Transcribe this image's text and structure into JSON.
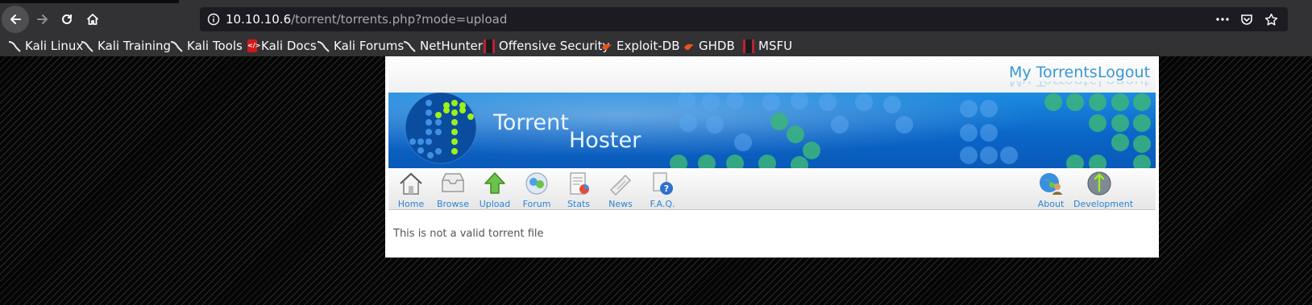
{
  "browser": {
    "url_host": "10.10.10.6",
    "url_path": "/torrent/torrents.php?mode=upload"
  },
  "bookmarks": [
    {
      "label": "Kali Linux",
      "icon": "kali-dragon-icon"
    },
    {
      "label": "Kali Training",
      "icon": "kali-dragon-icon"
    },
    {
      "label": "Kali Tools",
      "icon": "kali-dragon-icon"
    },
    {
      "label": "Kali Docs",
      "icon": "kali-docs-icon"
    },
    {
      "label": "Kali Forums",
      "icon": "kali-dragon-icon"
    },
    {
      "label": "NetHunter",
      "icon": "kali-dragon-icon"
    },
    {
      "label": "Offensive Security",
      "icon": "offsec-icon"
    },
    {
      "label": "Exploit-DB",
      "icon": "exploitdb-icon"
    },
    {
      "label": "GHDB",
      "icon": "exploitdb-icon"
    },
    {
      "label": "MSFU",
      "icon": "offsec-icon"
    }
  ],
  "site": {
    "header_links": {
      "my_torrents": "My Torrents",
      "logout": "Logout"
    },
    "logo": {
      "line1": "Torrent",
      "line2": "Hoster"
    },
    "menu": {
      "home": "Home",
      "browse": "Browse",
      "upload": "Upload",
      "forum": "Forum",
      "stats": "Stats",
      "news": "News",
      "faq": "F.A.Q.",
      "about": "About",
      "development": "Development"
    },
    "message": "This is not a valid torrent file"
  },
  "colors": {
    "link_blue": "#3797d8",
    "banner_blue": "#0a66c8",
    "dot_green": "#9ef01a"
  }
}
